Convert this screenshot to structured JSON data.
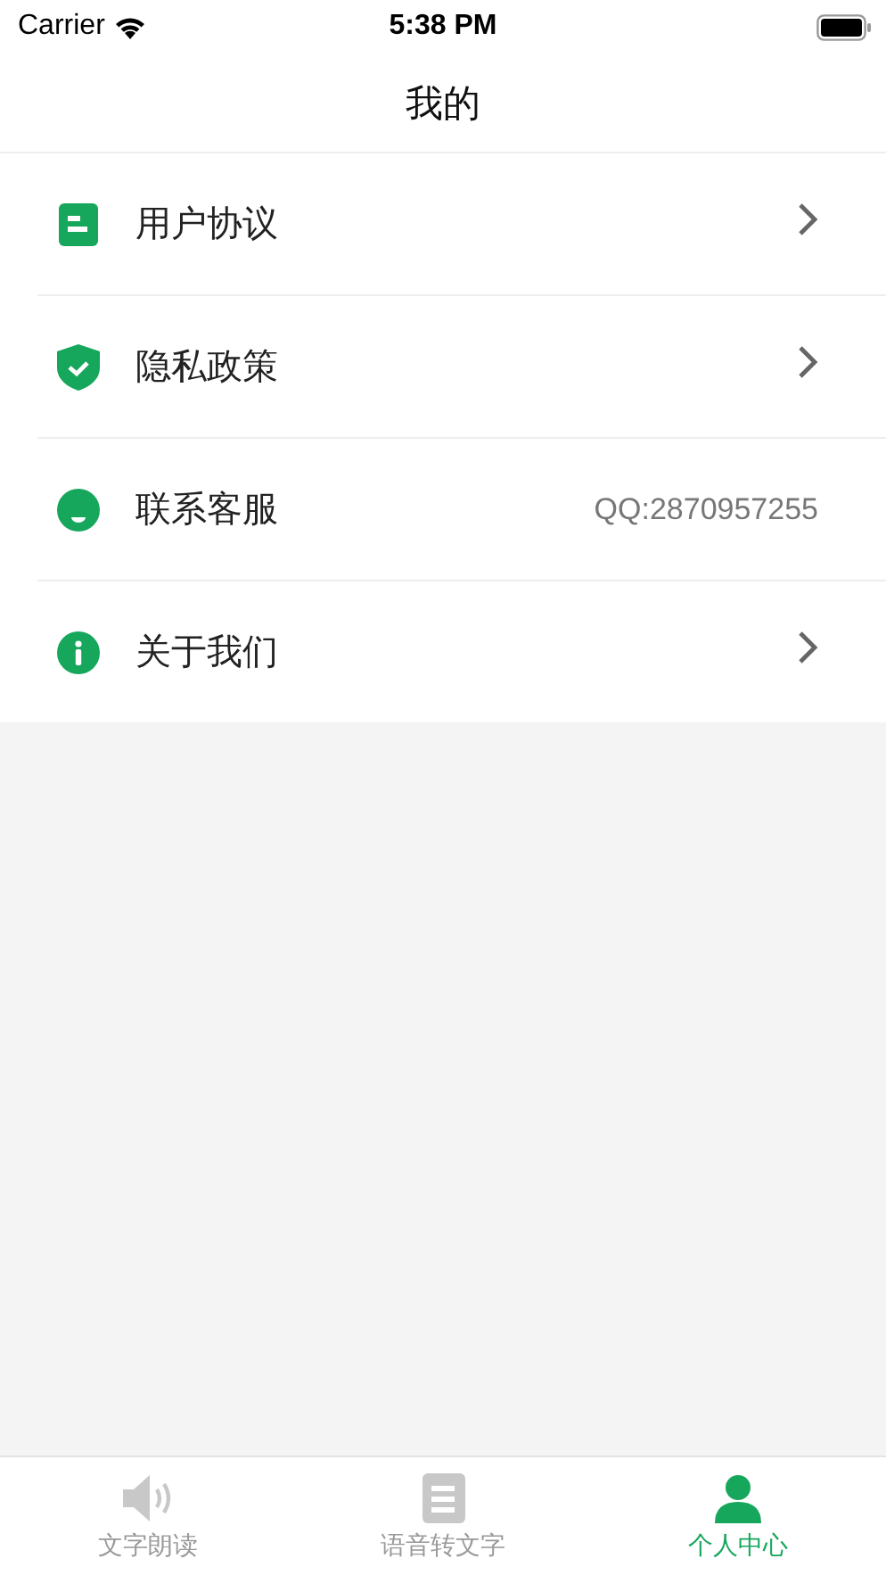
{
  "status_bar": {
    "carrier": "Carrier",
    "time": "5:38 PM"
  },
  "nav_bar": {
    "title": "我的"
  },
  "menu": [
    {
      "label": "用户协议",
      "kind": "link"
    },
    {
      "label": "隐私政策",
      "kind": "link"
    },
    {
      "label": "联系客服",
      "kind": "info",
      "value": "QQ:2870957255"
    },
    {
      "label": "关于我们",
      "kind": "link"
    }
  ],
  "tab_bar": [
    {
      "label": "文字朗读",
      "selected": false
    },
    {
      "label": "语音转文字",
      "selected": false
    },
    {
      "label": "个人中心",
      "selected": true
    }
  ]
}
